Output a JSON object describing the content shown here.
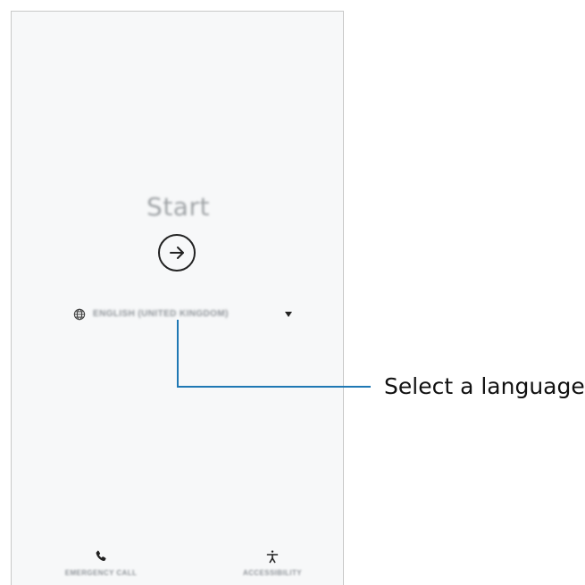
{
  "screen": {
    "start_label": "Start",
    "language_selector": {
      "selected_value": "ENGLISH (UNITED KINGDOM)"
    },
    "bottom_actions": {
      "emergency_call_label": "EMERGENCY CALL",
      "accessibility_label": "ACCESSIBILITY"
    }
  },
  "callout": {
    "text": "Select a language.",
    "line_color": "#1f78b4"
  },
  "icons": {
    "start": "arrow-right-circle-icon",
    "language": "globe-icon",
    "dropdown": "dropdown-arrow-icon",
    "emergency": "phone-icon",
    "accessibility": "accessibility-icon"
  }
}
